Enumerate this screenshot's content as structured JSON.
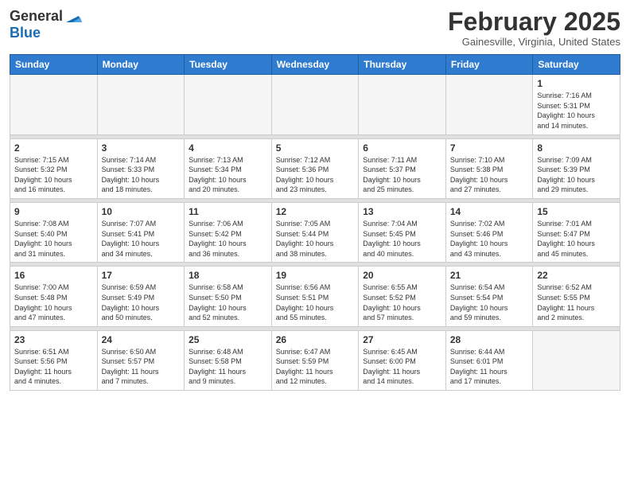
{
  "logo": {
    "general": "General",
    "blue": "Blue"
  },
  "header": {
    "month": "February 2025",
    "location": "Gainesville, Virginia, United States"
  },
  "weekdays": [
    "Sunday",
    "Monday",
    "Tuesday",
    "Wednesday",
    "Thursday",
    "Friday",
    "Saturday"
  ],
  "weeks": [
    [
      {
        "day": "",
        "info": ""
      },
      {
        "day": "",
        "info": ""
      },
      {
        "day": "",
        "info": ""
      },
      {
        "day": "",
        "info": ""
      },
      {
        "day": "",
        "info": ""
      },
      {
        "day": "",
        "info": ""
      },
      {
        "day": "1",
        "info": "Sunrise: 7:16 AM\nSunset: 5:31 PM\nDaylight: 10 hours\nand 14 minutes."
      }
    ],
    [
      {
        "day": "2",
        "info": "Sunrise: 7:15 AM\nSunset: 5:32 PM\nDaylight: 10 hours\nand 16 minutes."
      },
      {
        "day": "3",
        "info": "Sunrise: 7:14 AM\nSunset: 5:33 PM\nDaylight: 10 hours\nand 18 minutes."
      },
      {
        "day": "4",
        "info": "Sunrise: 7:13 AM\nSunset: 5:34 PM\nDaylight: 10 hours\nand 20 minutes."
      },
      {
        "day": "5",
        "info": "Sunrise: 7:12 AM\nSunset: 5:36 PM\nDaylight: 10 hours\nand 23 minutes."
      },
      {
        "day": "6",
        "info": "Sunrise: 7:11 AM\nSunset: 5:37 PM\nDaylight: 10 hours\nand 25 minutes."
      },
      {
        "day": "7",
        "info": "Sunrise: 7:10 AM\nSunset: 5:38 PM\nDaylight: 10 hours\nand 27 minutes."
      },
      {
        "day": "8",
        "info": "Sunrise: 7:09 AM\nSunset: 5:39 PM\nDaylight: 10 hours\nand 29 minutes."
      }
    ],
    [
      {
        "day": "9",
        "info": "Sunrise: 7:08 AM\nSunset: 5:40 PM\nDaylight: 10 hours\nand 31 minutes."
      },
      {
        "day": "10",
        "info": "Sunrise: 7:07 AM\nSunset: 5:41 PM\nDaylight: 10 hours\nand 34 minutes."
      },
      {
        "day": "11",
        "info": "Sunrise: 7:06 AM\nSunset: 5:42 PM\nDaylight: 10 hours\nand 36 minutes."
      },
      {
        "day": "12",
        "info": "Sunrise: 7:05 AM\nSunset: 5:44 PM\nDaylight: 10 hours\nand 38 minutes."
      },
      {
        "day": "13",
        "info": "Sunrise: 7:04 AM\nSunset: 5:45 PM\nDaylight: 10 hours\nand 40 minutes."
      },
      {
        "day": "14",
        "info": "Sunrise: 7:02 AM\nSunset: 5:46 PM\nDaylight: 10 hours\nand 43 minutes."
      },
      {
        "day": "15",
        "info": "Sunrise: 7:01 AM\nSunset: 5:47 PM\nDaylight: 10 hours\nand 45 minutes."
      }
    ],
    [
      {
        "day": "16",
        "info": "Sunrise: 7:00 AM\nSunset: 5:48 PM\nDaylight: 10 hours\nand 47 minutes."
      },
      {
        "day": "17",
        "info": "Sunrise: 6:59 AM\nSunset: 5:49 PM\nDaylight: 10 hours\nand 50 minutes."
      },
      {
        "day": "18",
        "info": "Sunrise: 6:58 AM\nSunset: 5:50 PM\nDaylight: 10 hours\nand 52 minutes."
      },
      {
        "day": "19",
        "info": "Sunrise: 6:56 AM\nSunset: 5:51 PM\nDaylight: 10 hours\nand 55 minutes."
      },
      {
        "day": "20",
        "info": "Sunrise: 6:55 AM\nSunset: 5:52 PM\nDaylight: 10 hours\nand 57 minutes."
      },
      {
        "day": "21",
        "info": "Sunrise: 6:54 AM\nSunset: 5:54 PM\nDaylight: 10 hours\nand 59 minutes."
      },
      {
        "day": "22",
        "info": "Sunrise: 6:52 AM\nSunset: 5:55 PM\nDaylight: 11 hours\nand 2 minutes."
      }
    ],
    [
      {
        "day": "23",
        "info": "Sunrise: 6:51 AM\nSunset: 5:56 PM\nDaylight: 11 hours\nand 4 minutes."
      },
      {
        "day": "24",
        "info": "Sunrise: 6:50 AM\nSunset: 5:57 PM\nDaylight: 11 hours\nand 7 minutes."
      },
      {
        "day": "25",
        "info": "Sunrise: 6:48 AM\nSunset: 5:58 PM\nDaylight: 11 hours\nand 9 minutes."
      },
      {
        "day": "26",
        "info": "Sunrise: 6:47 AM\nSunset: 5:59 PM\nDaylight: 11 hours\nand 12 minutes."
      },
      {
        "day": "27",
        "info": "Sunrise: 6:45 AM\nSunset: 6:00 PM\nDaylight: 11 hours\nand 14 minutes."
      },
      {
        "day": "28",
        "info": "Sunrise: 6:44 AM\nSunset: 6:01 PM\nDaylight: 11 hours\nand 17 minutes."
      },
      {
        "day": "",
        "info": ""
      }
    ]
  ]
}
